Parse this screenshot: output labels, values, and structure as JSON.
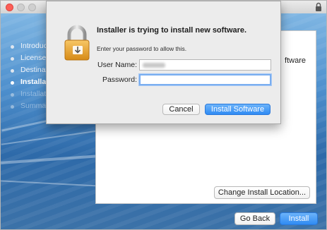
{
  "sidebar": {
    "steps": [
      {
        "label": "Introduc",
        "state": "done"
      },
      {
        "label": "License",
        "state": "done"
      },
      {
        "label": "Destinati",
        "state": "done"
      },
      {
        "label": "Installati",
        "state": "active"
      },
      {
        "label": "Installati",
        "state": "pending"
      },
      {
        "label": "Summa",
        "state": "pending"
      }
    ]
  },
  "content": {
    "partial_text": "ftware"
  },
  "buttons": {
    "change_location": "Change Install Location...",
    "go_back": "Go Back",
    "install": "Install"
  },
  "dialog": {
    "title": "Installer is trying to install new software.",
    "subtitle": "Enter your password to allow this.",
    "username_label": "User Name:",
    "password_label": "Password:",
    "username_value": "",
    "password_value": "",
    "cancel": "Cancel",
    "install_software": "Install Software"
  },
  "colors": {
    "accent": "#2f8bf3",
    "close_button": "#fc5f57"
  }
}
